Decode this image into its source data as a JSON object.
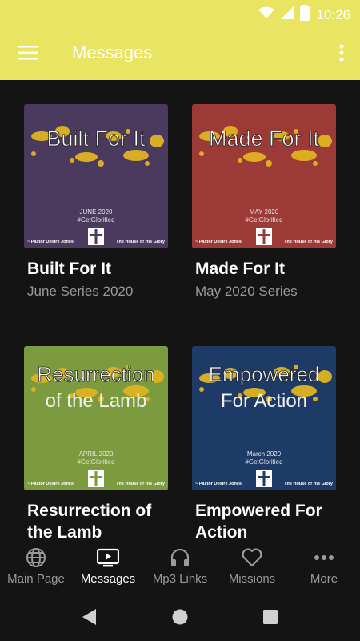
{
  "status_bar": {
    "time": "10:26",
    "icons": [
      "wifi-icon",
      "signal-icon",
      "battery-icon"
    ]
  },
  "app_bar": {
    "title": "Messages",
    "menu_icon": "hamburger-menu-icon",
    "overflow_icon": "more-vert-icon",
    "background": "#E9E461"
  },
  "cards": [
    {
      "title": "Built For It",
      "subtitle": "June Series 2020",
      "cover": {
        "bg": "#4A3A5E",
        "headline": "Built For It",
        "headline2": "",
        "date": "JUNE 2020",
        "tag": "#GetGlorified",
        "pastor": "~ Pastor Deidre Jones",
        "church": "The House of His Glory"
      }
    },
    {
      "title": "Made For It",
      "subtitle": "May 2020 Series",
      "cover": {
        "bg": "#9B3A36",
        "headline": "Made For It",
        "headline2": "",
        "date": "MAY 2020",
        "tag": "#GetGlorified",
        "pastor": "~ Pastor Deidre Jones",
        "church": "The House of His Glory"
      }
    },
    {
      "title": "Resurrection of the Lamb",
      "subtitle": "",
      "cover": {
        "bg": "#7C9A3E",
        "headline": "Resurrection",
        "headline2": "of the Lamb",
        "date": "APRIL 2020",
        "tag": "#GetGlorified",
        "pastor": "~ Pastor Deidre Jones",
        "church": "The House of His Glory"
      }
    },
    {
      "title": "Empowered For Action",
      "subtitle": "",
      "cover": {
        "bg": "#1E3A66",
        "headline": "Empowered",
        "headline2": "For Action",
        "date": "March 2020",
        "tag": "#GetGlorified",
        "pastor": "~ Pastor Deidre Jones",
        "church": "The House of His Glory"
      }
    }
  ],
  "bottom_nav": [
    {
      "label": "Main Page",
      "icon": "globe-icon",
      "active": false
    },
    {
      "label": "Messages",
      "icon": "tv-play-icon",
      "active": true
    },
    {
      "label": "Mp3 Links",
      "icon": "headphones-icon",
      "active": false
    },
    {
      "label": "Missions",
      "icon": "heart-icon",
      "active": false
    },
    {
      "label": "More",
      "icon": "more-horiz-icon",
      "active": false
    }
  ],
  "system_nav": [
    "back-icon",
    "home-icon",
    "recents-icon"
  ],
  "colors": {
    "accent": "#E9E461",
    "splatter": "#E0B420",
    "background": "#141414"
  }
}
